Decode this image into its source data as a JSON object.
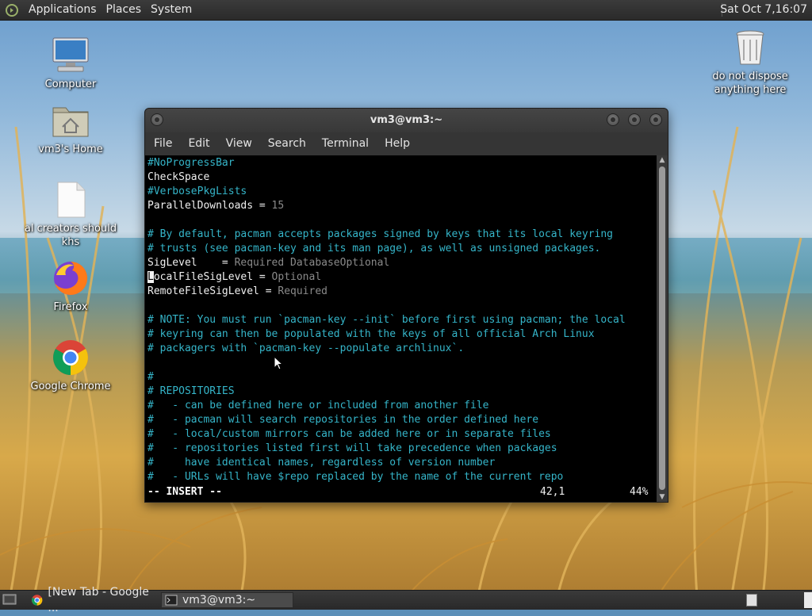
{
  "top_panel": {
    "menus": [
      "Applications",
      "Places",
      "System"
    ],
    "clock": "Sat Oct  7,16:07"
  },
  "desktop": {
    "icons": [
      {
        "label": "Computer",
        "icon": "computer-icon"
      },
      {
        "label": "vm3's Home",
        "icon": "home-folder-icon"
      },
      {
        "label": "al creators should khs",
        "icon": "file-icon"
      },
      {
        "label": "Firefox",
        "icon": "firefox-icon"
      },
      {
        "label": "Google Chrome",
        "icon": "chrome-icon"
      },
      {
        "label": "do not dispose anything here",
        "icon": "trash-icon"
      }
    ]
  },
  "terminal": {
    "title": "vm3@vm3:~",
    "menus": [
      "File",
      "Edit",
      "View",
      "Search",
      "Terminal",
      "Help"
    ],
    "lines": [
      [
        {
          "t": "#NoProgressBar",
          "c": "cyan"
        }
      ],
      [
        {
          "t": "CheckSpace",
          "c": "white"
        }
      ],
      [
        {
          "t": "#VerbosePkgLists",
          "c": "cyan"
        }
      ],
      [
        {
          "t": "ParallelDownloads = ",
          "c": "white"
        },
        {
          "t": "15",
          "c": "gray"
        }
      ],
      [],
      [
        {
          "t": "# By default, pacman accepts packages signed by keys that its local keyring",
          "c": "cyan"
        }
      ],
      [
        {
          "t": "# trusts (see pacman-key and its man page), as well as unsigned packages.",
          "c": "cyan"
        }
      ],
      [
        {
          "t": "SigLevel    = ",
          "c": "white"
        },
        {
          "t": "Required DatabaseOptional",
          "c": "gray"
        }
      ],
      [
        {
          "t": "L",
          "c": "cursor"
        },
        {
          "t": "ocalFileSigLevel = ",
          "c": "white"
        },
        {
          "t": "Optional",
          "c": "gray"
        }
      ],
      [
        {
          "t": "RemoteFileSigLevel = ",
          "c": "white"
        },
        {
          "t": "Required",
          "c": "gray"
        }
      ],
      [],
      [
        {
          "t": "# NOTE: You must run `pacman-key --init` before first using pacman; the local",
          "c": "cyan"
        }
      ],
      [
        {
          "t": "# keyring can then be populated with the keys of all official Arch Linux",
          "c": "cyan"
        }
      ],
      [
        {
          "t": "# packagers with `pacman-key --populate archlinux`.",
          "c": "cyan"
        }
      ],
      [],
      [
        {
          "t": "#",
          "c": "cyan"
        }
      ],
      [
        {
          "t": "# REPOSITORIES",
          "c": "cyan"
        }
      ],
      [
        {
          "t": "#   - can be defined here or included from another file",
          "c": "cyan"
        }
      ],
      [
        {
          "t": "#   - pacman will search repositories in the order defined here",
          "c": "cyan"
        }
      ],
      [
        {
          "t": "#   - local/custom mirrors can be added here or in separate files",
          "c": "cyan"
        }
      ],
      [
        {
          "t": "#   - repositories listed first will take precedence when packages",
          "c": "cyan"
        }
      ],
      [
        {
          "t": "#     have identical names, regardless of version number",
          "c": "cyan"
        }
      ],
      [
        {
          "t": "#   - URLs will have $repo replaced by the name of the current repo",
          "c": "cyan"
        }
      ]
    ],
    "status": {
      "mode": "-- INSERT --",
      "position": "42,1",
      "percent": "44%"
    },
    "scroll": {
      "thumb_start": 0.0,
      "thumb_size": 1.0
    }
  },
  "taskbar": {
    "tasks": [
      {
        "label": "[New Tab - Google ...",
        "icon": "chrome-icon",
        "active": false
      },
      {
        "label": "vm3@vm3:~",
        "icon": "terminal-icon",
        "active": true
      }
    ]
  },
  "colors": {
    "cyan": "#35b5c9",
    "white": "#f0f0f0",
    "gray": "#8a8a8a",
    "panel": "#2f2f2f"
  }
}
